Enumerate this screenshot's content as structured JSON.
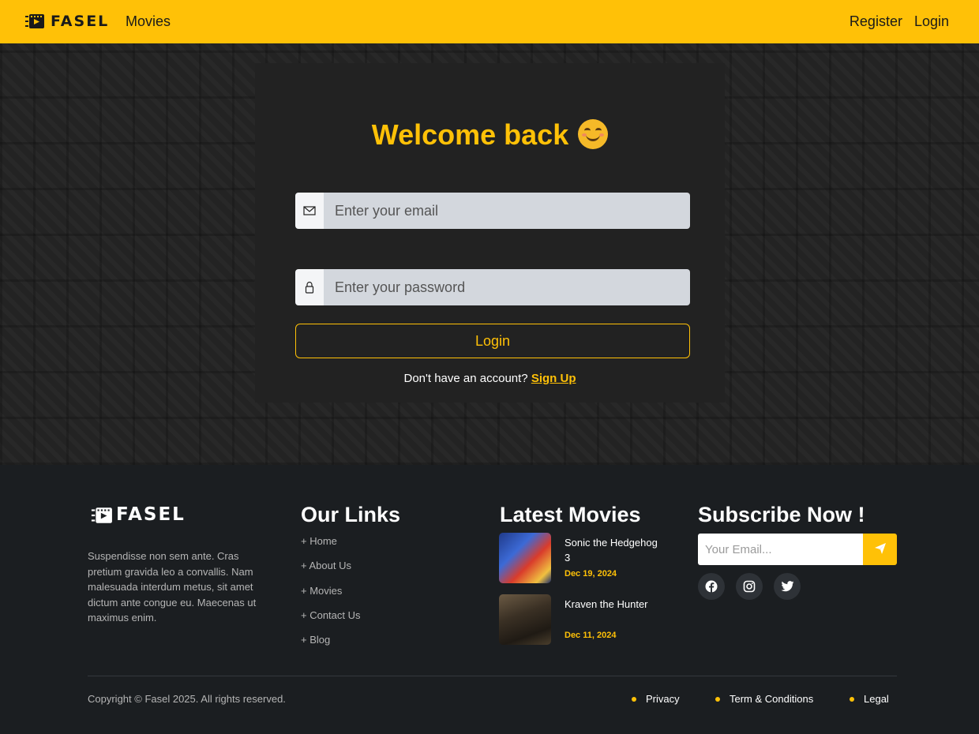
{
  "header": {
    "brand": "FASEL",
    "nav_movies": "Movies",
    "register": "Register",
    "login": "Login"
  },
  "login_form": {
    "title": "Welcome back",
    "email_placeholder": "Enter your email",
    "password_placeholder": "Enter your password",
    "submit_label": "Login",
    "signup_prompt": "Don't have an account?",
    "signup_link": "Sign Up"
  },
  "footer": {
    "brand": "FASEL",
    "about": "Suspendisse non sem ante. Cras pretium gravida leo a convallis. Nam malesuada interdum metus, sit amet dictum ante congue eu. Maecenas ut maximus enim.",
    "links_heading": "Our Links",
    "links": [
      "+ Home",
      "+ About Us",
      "+ Movies",
      "+ Contact Us",
      "+ Blog"
    ],
    "latest_heading": "Latest Movies",
    "latest_movies": [
      {
        "title": "Sonic the Hedgehog 3",
        "date": "Dec 19, 2024"
      },
      {
        "title": "Kraven the Hunter",
        "date": "Dec 11, 2024"
      }
    ],
    "subscribe_heading": "Subscribe Now !",
    "subscribe_placeholder": "Your Email...",
    "social_icons": [
      "facebook-icon",
      "instagram-icon",
      "twitter-icon"
    ],
    "copyright": "Copyright © Fasel 2025. All rights reserved.",
    "legal_links": [
      "Privacy",
      "Term & Conditions",
      "Legal"
    ]
  },
  "colors": {
    "accent": "#ffc107",
    "footer_bg": "#1b1e21",
    "card_bg": "#222222"
  }
}
